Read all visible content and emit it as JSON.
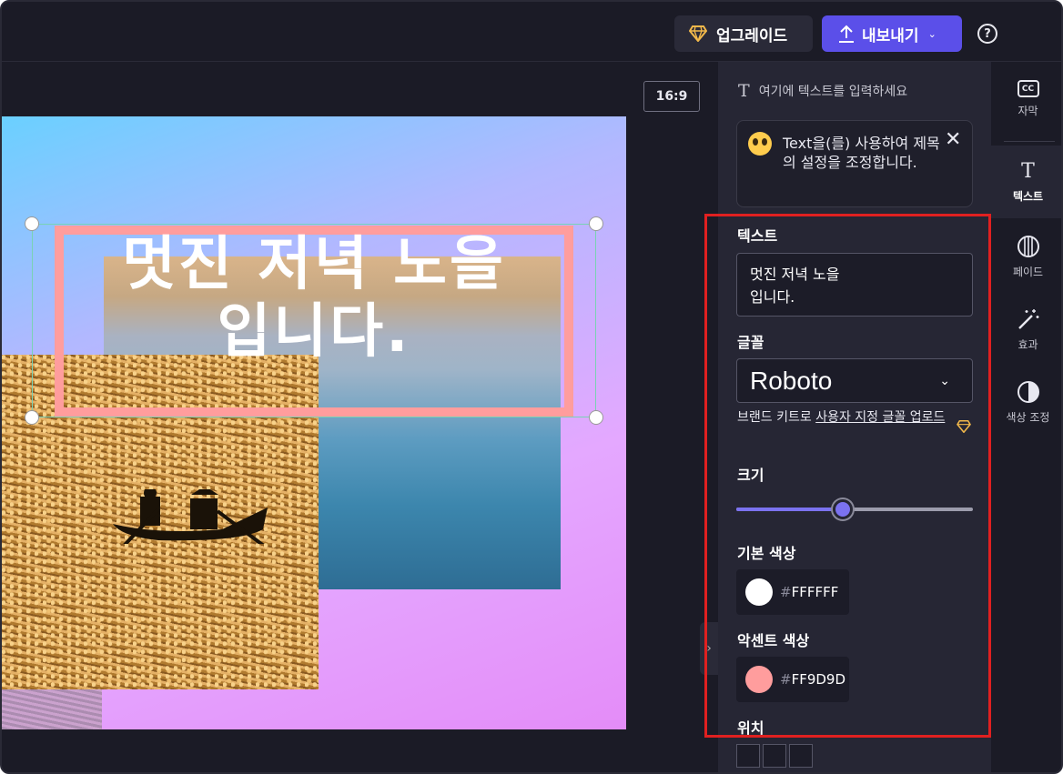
{
  "header": {
    "upgrade_label": "업그레이드",
    "export_label": "내보내기",
    "help_icon": "question-icon"
  },
  "stage": {
    "aspect_ratio": "16:9",
    "title_line1": "멋진 저녁 노을",
    "title_line2": "입니다."
  },
  "panel": {
    "hint": "여기에 텍스트를 입력하세요",
    "tip": "Text을(를) 사용하여 제목의 설정을 조정합니다.",
    "text_label": "텍스트",
    "text_value": "멋진 저녁 노을\n입니다.",
    "font_label": "글꼴",
    "font_value": "Roboto",
    "brand_prefix": "브랜드 키트로 ",
    "brand_link": "사용자 지정 글꼴 업로드",
    "size_label": "크기",
    "size_slider_fraction": 0.45,
    "base_color_label": "기본 색상",
    "base_color_hex": "FFFFFF",
    "base_color": "#FFFFFF",
    "accent_color_label": "악센트 색상",
    "accent_color_hex": "FF9D9D",
    "accent_color": "#FF9D9D",
    "position_label": "위치"
  },
  "rail": {
    "items": [
      {
        "label": "자막",
        "icon": "cc-icon"
      },
      {
        "label": "텍스트",
        "icon": "text-icon"
      },
      {
        "label": "페이드",
        "icon": "fade-icon"
      },
      {
        "label": "효과",
        "icon": "magic-wand-icon"
      },
      {
        "label": "색상 조정",
        "icon": "contrast-icon"
      }
    ]
  },
  "colors": {
    "export": "#5B4FE9",
    "slider": "#7B72F0",
    "highlight_frame": "#E02020"
  }
}
